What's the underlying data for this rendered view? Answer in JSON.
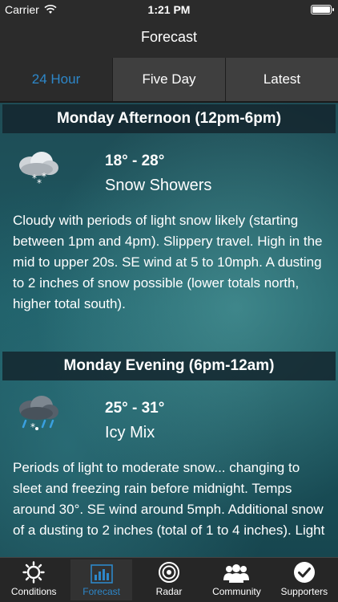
{
  "status_bar": {
    "carrier": "Carrier",
    "time": "1:21 PM"
  },
  "nav": {
    "title": "Forecast"
  },
  "tabs": [
    {
      "label": "24 Hour",
      "active": true
    },
    {
      "label": "Five Day",
      "active": false
    },
    {
      "label": "Latest",
      "active": false
    }
  ],
  "periods": [
    {
      "header": "Monday Afternoon (12pm-6pm)",
      "icon": "snow-showers-icon",
      "temp": "18° - 28°",
      "condition": "Snow Showers",
      "description": "Cloudy with periods of light snow likely (starting between 1pm and 4pm). Slippery travel. High in the mid to upper 20s. SE wind at 5 to 10mph. A dusting to 2 inches of snow possible (lower totals north, higher total south)."
    },
    {
      "header": "Monday Evening (6pm-12am)",
      "icon": "icy-mix-icon",
      "temp": "25° - 31°",
      "condition": "Icy Mix",
      "description": "Periods of light to moderate snow... changing to sleet and freezing rain before midnight. Temps around 30°. SE wind around 5mph. Additional snow of a dusting to 2 inches (total of 1 to 4 inches). Light"
    }
  ],
  "tab_bar": [
    {
      "label": "Conditions",
      "icon": "sun-icon",
      "active": false
    },
    {
      "label": "Forecast",
      "icon": "bar-chart-icon",
      "active": true
    },
    {
      "label": "Radar",
      "icon": "radar-icon",
      "active": false
    },
    {
      "label": "Community",
      "icon": "community-icon",
      "active": false
    },
    {
      "label": "Supporters",
      "icon": "checkmark-icon",
      "active": false
    }
  ],
  "colors": {
    "accent": "#2d87c9",
    "bar": "#262626",
    "header_bg": "#14262e"
  }
}
